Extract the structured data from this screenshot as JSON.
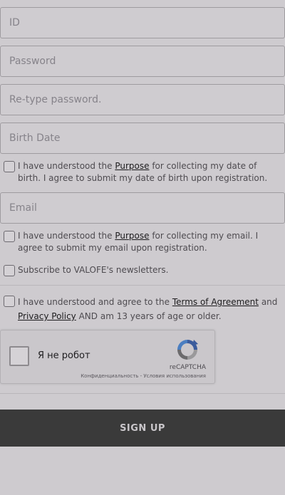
{
  "form": {
    "id_placeholder": "ID",
    "password_placeholder": "Password",
    "retype_placeholder": "Re-type password.",
    "birthdate_placeholder": "Birth Date",
    "email_placeholder": "Email"
  },
  "consent_birth": {
    "pre": "I have understood the ",
    "link": "Purpose",
    "post": " for collecting my date of birth. I agree to submit my date of birth upon registration."
  },
  "consent_email": {
    "pre": "I have understood the ",
    "link": "Purpose",
    "post": " for collecting my email. I agree to submit my email upon registration."
  },
  "newsletter": {
    "label": "Subscribe to VALOFE's newsletters."
  },
  "terms": {
    "pre": "I have understood and agree to the ",
    "link1": "Terms of Agreement",
    "mid": " and ",
    "link2": "Privacy Policy",
    "post": " AND am 13 years of age or older."
  },
  "recaptcha": {
    "label": "Я не робот",
    "brand": "reCAPTCHA",
    "privacy": "Конфиденциальность",
    "separator": " - ",
    "terms": "Условия использования"
  },
  "signup": {
    "label": "SIGN UP"
  },
  "colors": {
    "background": "#cecbcf",
    "button": "#3a3a3a",
    "link": "#1d1c1e"
  }
}
